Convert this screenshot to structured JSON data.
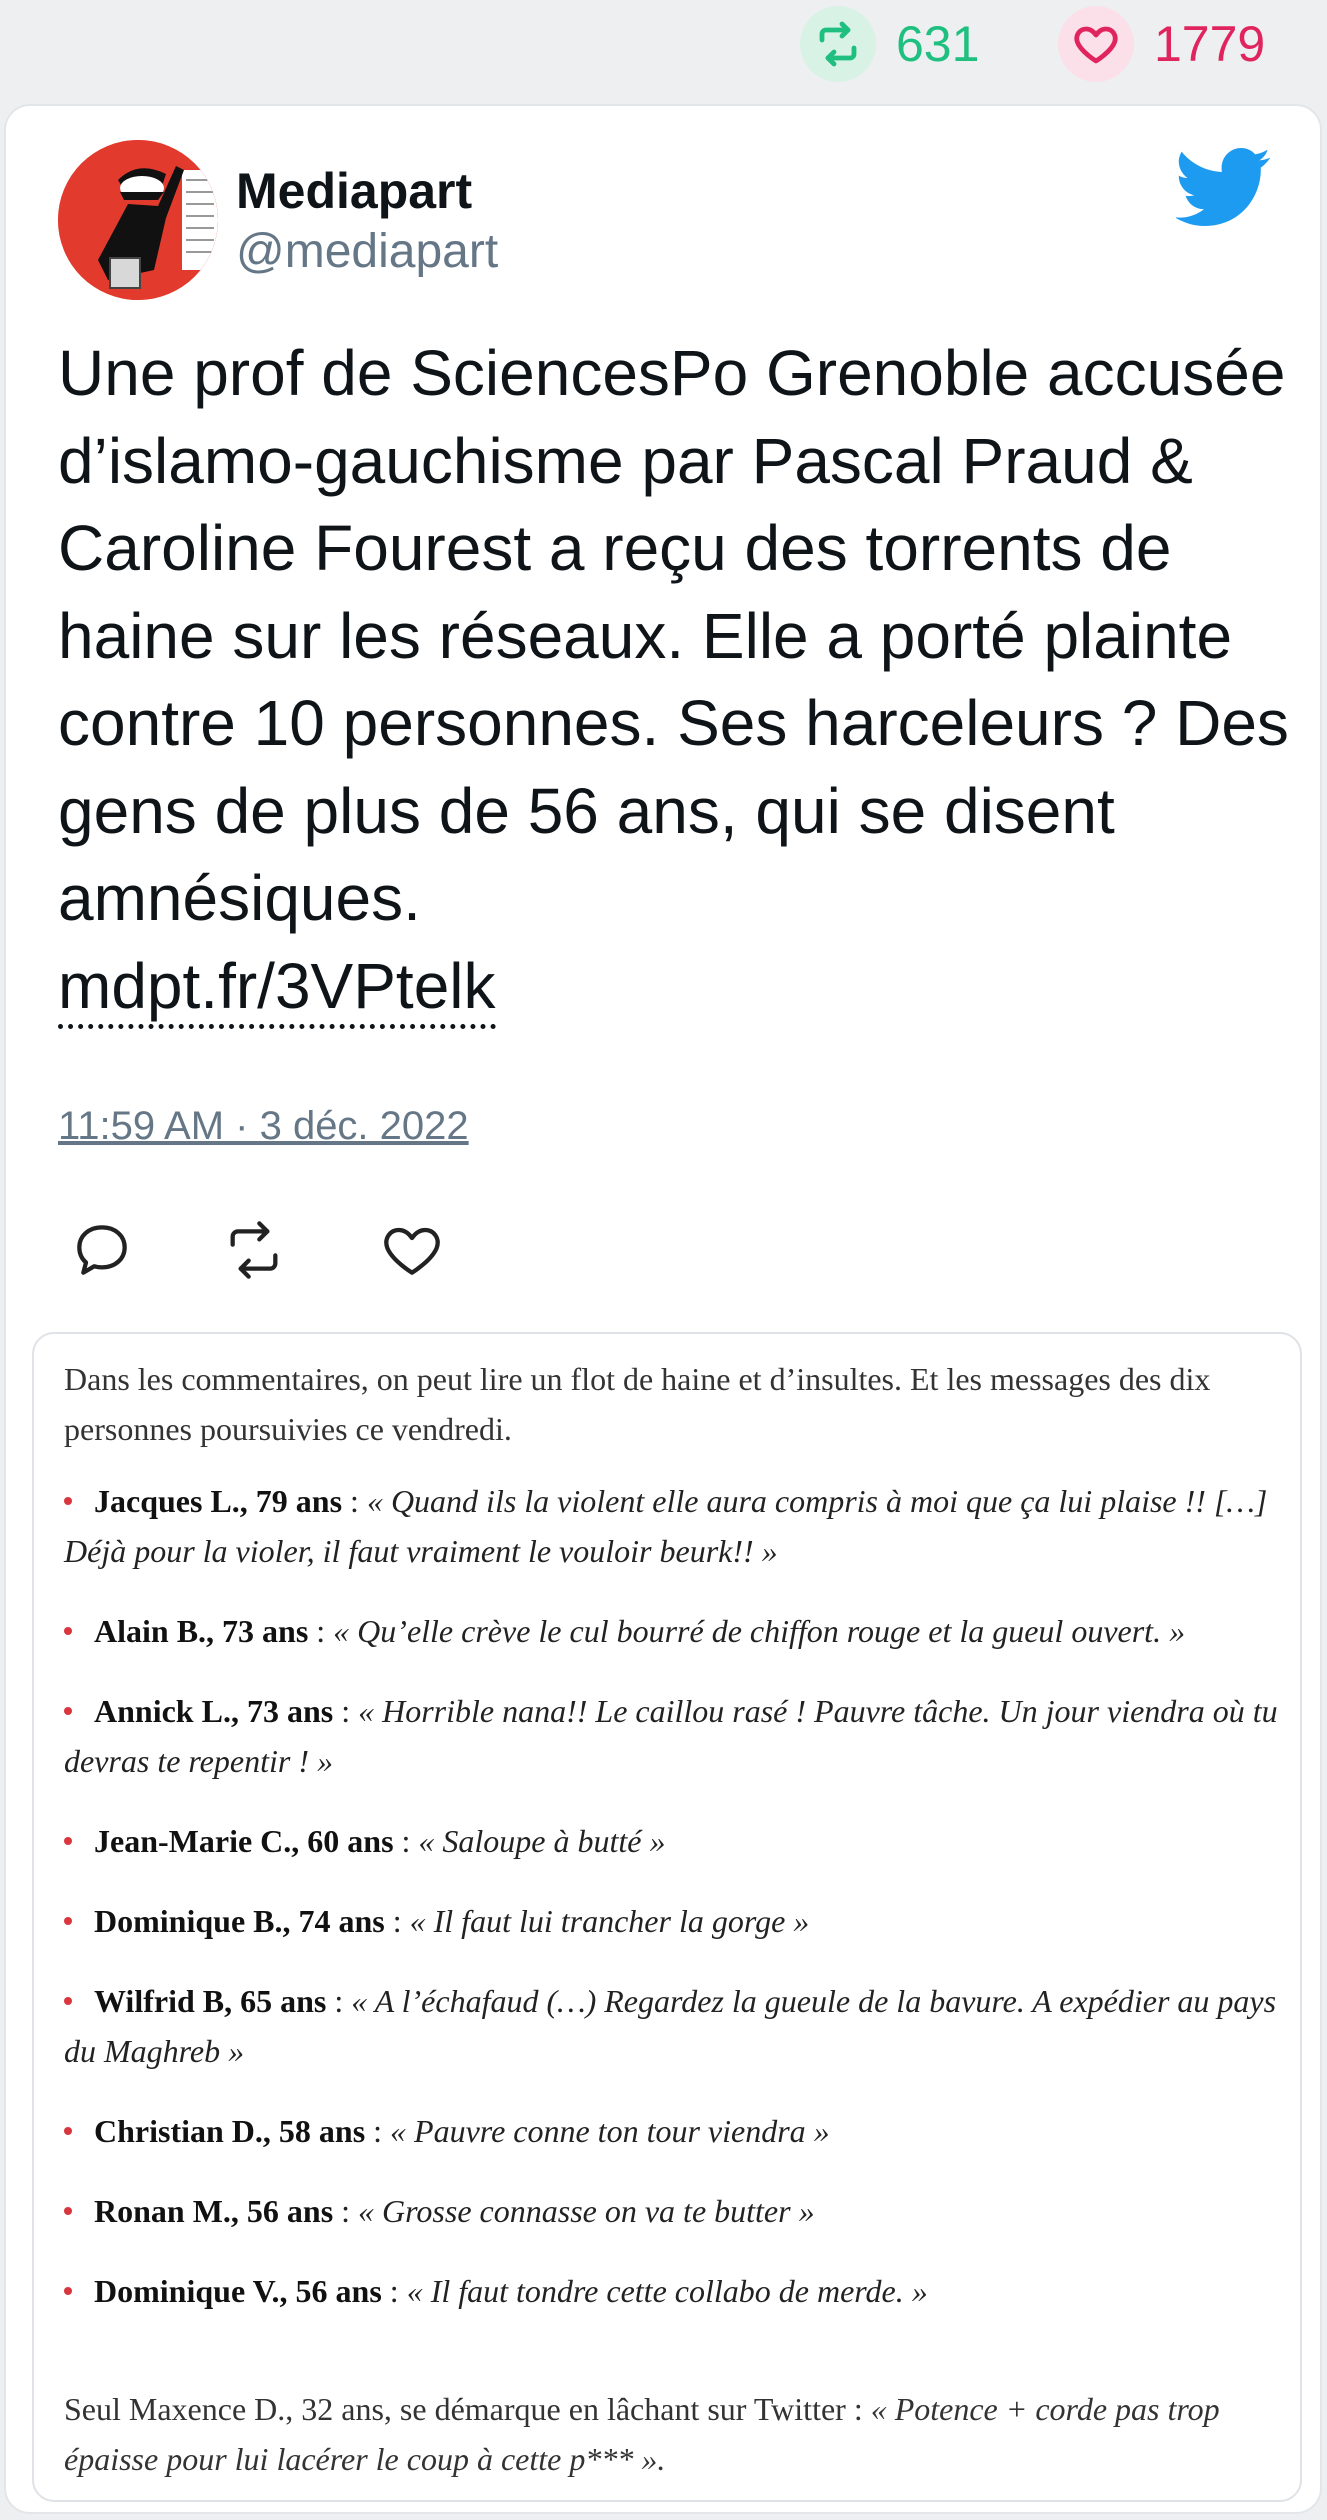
{
  "stats": {
    "retweets": "631",
    "likes": "1779"
  },
  "colors": {
    "retweet_green": "#1fbf80",
    "like_pink": "#e0245e",
    "twitter_blue": "#1d9bf0",
    "handle_gray": "#657786"
  },
  "author": {
    "name": "Mediapart",
    "handle": "@mediapart",
    "avatar_icon": "mediapart-logo"
  },
  "tweet": {
    "text": "Une prof de SciencesPo Grenoble accusée d’islamo-gauchisme par Pascal Praud & Caroline Fourest a reçu des torrents de haine sur les réseaux. Elle a porté plainte contre 10 personnes. Ses harceleurs ? Des gens de plus de 56 ans, qui se disent amnésiques.",
    "link": "mdpt.fr/3VPtelk",
    "timestamp": "11:59 AM · 3 déc. 2022"
  },
  "icons": {
    "reply": "reply-icon",
    "retweet": "retweet-icon",
    "like": "heart-icon",
    "brand": "twitter-bird-icon"
  },
  "media": {
    "intro": "Dans les commentaires, on peut lire un flot de haine et d’insultes. Et les messages des dix personnes poursuivies ce vendredi.",
    "items": [
      {
        "name": "Jacques L., 79 ans",
        "sep": " : ",
        "quote": "« Quand ils la violent elle aura compris à moi que ça lui plaise !! […] Déjà pour la violer, il faut vraiment le vouloir beurk!! »"
      },
      {
        "name": "Alain B., 73 ans",
        "sep": " : ",
        "quote": "« Qu’elle crève le cul bourré de chiffon rouge et la gueul ouvert. »"
      },
      {
        "name": "Annick L., 73 ans",
        "sep": " : ",
        "quote": "« Horrible nana!! Le caillou rasé ! Pauvre tâche. Un jour viendra où tu devras te repentir ! »"
      },
      {
        "name": "Jean-Marie C., 60 ans",
        "sep": " : ",
        "quote": "« Saloupe à butté »"
      },
      {
        "name": "Dominique B., 74 ans",
        "sep": " : ",
        "quote": "« Il faut lui trancher la gorge »"
      },
      {
        "name": "Wilfrid B, 65 ans",
        "sep": " : ",
        "quote": "« A l’échafaud (…) Regardez la gueule de la bavure. A expédier au pays du Maghreb »"
      },
      {
        "name": "Christian D., 58 ans",
        "sep": " : ",
        "quote": "« Pauvre conne ton tour viendra »"
      },
      {
        "name": "Ronan M., 56 ans",
        "sep": " : ",
        "quote": "« Grosse connasse on va te butter »"
      },
      {
        "name": "Dominique V., 56 ans",
        "sep": " : ",
        "quote": "« Il faut tondre cette collabo de merde. »"
      }
    ],
    "outro_lead": "Seul Maxence D., 32 ans, se démarque en lâchant sur Twitter : ",
    "outro_quote": "« Potence + corde pas trop épaisse pour lui lacérer le coup à cette p*** »."
  }
}
